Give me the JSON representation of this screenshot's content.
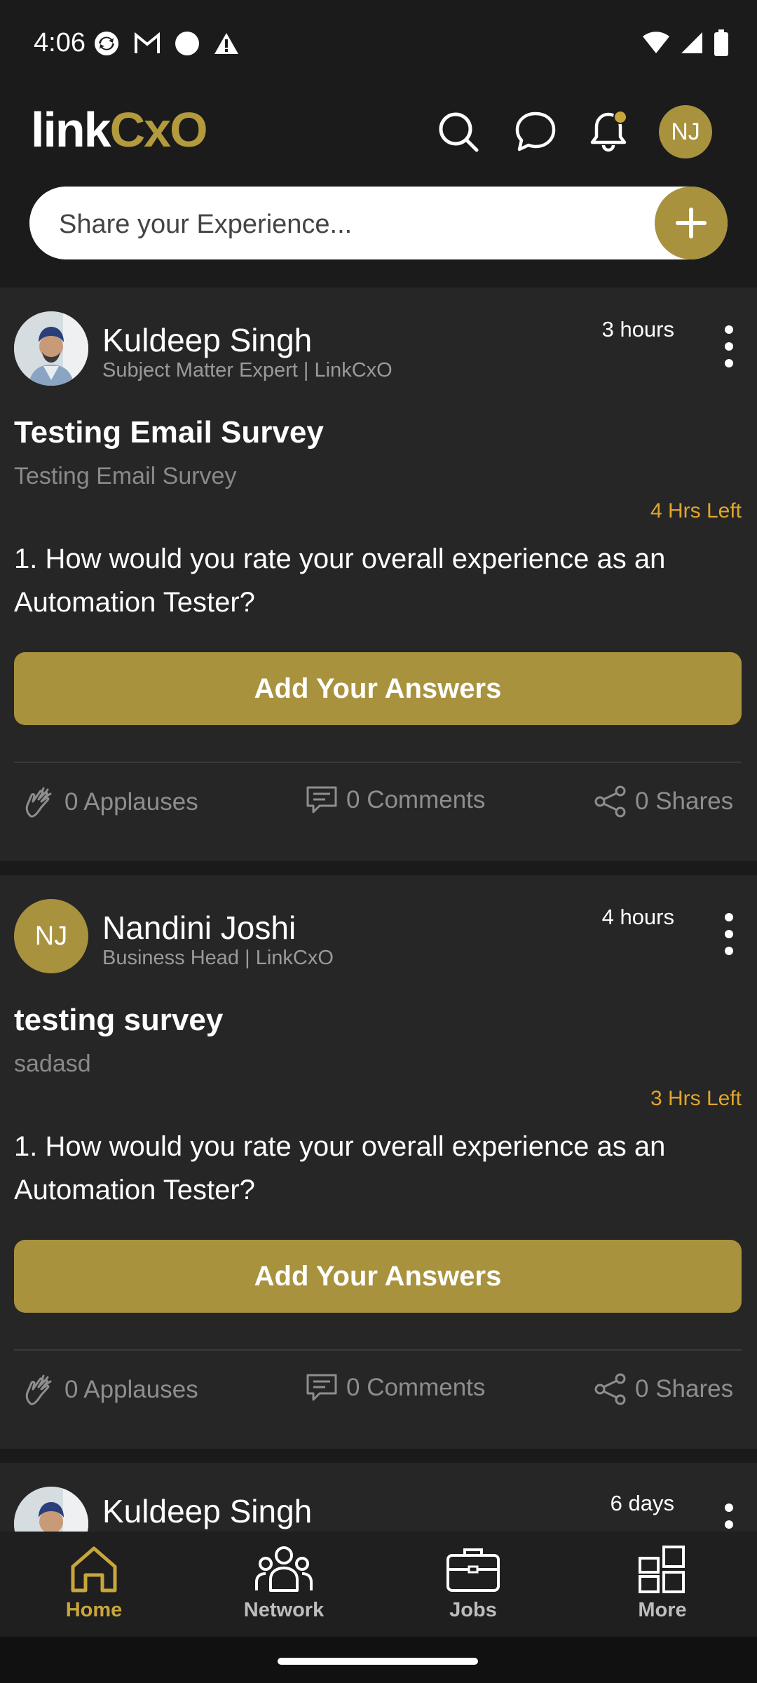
{
  "status_bar": {
    "time": "4:06",
    "left_icons": [
      "sync-icon",
      "gmail-icon",
      "circle-icon",
      "warning-icon"
    ],
    "right_icons": [
      "wifi-icon",
      "signal-icon",
      "battery-icon"
    ]
  },
  "header": {
    "logo_part1": "link",
    "logo_part2": "CxO",
    "avatar_initials": "NJ",
    "icons": [
      "search-icon",
      "chat-icon",
      "bell-icon"
    ],
    "share_placeholder": "Share your Experience...",
    "accent": "#a8923e"
  },
  "feed": {
    "posts": [
      {
        "author": "Kuldeep Singh",
        "author_title": "Subject Matter Expert | LinkCxO",
        "time": "3 hours",
        "title": "Testing Email Survey",
        "description": "Testing Email Survey",
        "time_left": "4 Hrs Left",
        "question": "1. How would you rate your overall experience as an Automation Tester?",
        "button": "Add Your Answers",
        "applauses": "0 Applauses",
        "comments": "0 Comments",
        "shares": "0 Shares"
      },
      {
        "author": "Nandini Joshi",
        "author_initials": "NJ",
        "author_title": "Business Head | LinkCxO",
        "time": "4 hours",
        "title": "testing survey",
        "description": "sadasd",
        "time_left": "3 Hrs Left",
        "question": "1. How would you rate your overall experience as an Automation Tester?",
        "button": "Add Your Answers",
        "applauses": "0 Applauses",
        "comments": "0 Comments",
        "shares": "0 Shares"
      },
      {
        "author": "Kuldeep Singh",
        "time": "6 days"
      }
    ]
  },
  "bottom_nav": {
    "items": [
      {
        "label": "Home",
        "icon": "home-icon",
        "active": true
      },
      {
        "label": "Network",
        "icon": "network-icon",
        "active": false
      },
      {
        "label": "Jobs",
        "icon": "briefcase-icon",
        "active": false
      },
      {
        "label": "More",
        "icon": "grid-icon",
        "active": false
      }
    ]
  }
}
